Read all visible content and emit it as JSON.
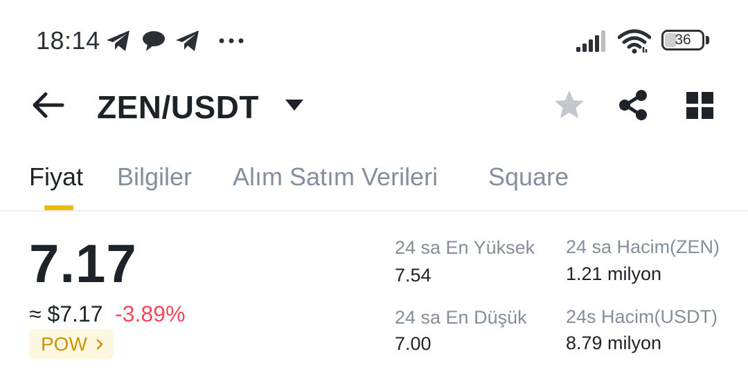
{
  "status_bar": {
    "time": "18:14",
    "battery": "36",
    "icons": [
      "telegram-icon",
      "chat-bubble-icon",
      "telegram-icon",
      "more-dots-icon",
      "signal-icon",
      "wifi-icon",
      "battery-icon"
    ]
  },
  "header": {
    "pair": "ZEN/USDT",
    "icons": [
      "back-arrow-icon",
      "caret-down-icon",
      "star-icon",
      "share-icon",
      "grid-icon"
    ]
  },
  "tabs": [
    {
      "label": "Fiyat",
      "active": true
    },
    {
      "label": "Bilgiler",
      "active": false
    },
    {
      "label": "Alım Satım Verileri",
      "active": false
    },
    {
      "label": "Square",
      "active": false
    }
  ],
  "price": {
    "last": "7.17",
    "usd": "≈ $7.17",
    "change": "-3.89%",
    "tag": "POW"
  },
  "stats": {
    "high_label": "24 sa En Yüksek",
    "high_value": "7.54",
    "low_label": "24 sa En Düşük",
    "low_value": "7.00",
    "vol_base_label": "24 sa Hacim(ZEN)",
    "vol_base_value": "1.21 milyon",
    "vol_quote_label": "24s Hacim(USDT)",
    "vol_quote_value": "8.79 milyon"
  },
  "colors": {
    "accent": "#f0b90b",
    "negative": "#f6465d",
    "text_primary": "#1e2329",
    "text_secondary": "#848e9c",
    "tag_bg": "#fdf6e0",
    "tag_text": "#c99400"
  }
}
